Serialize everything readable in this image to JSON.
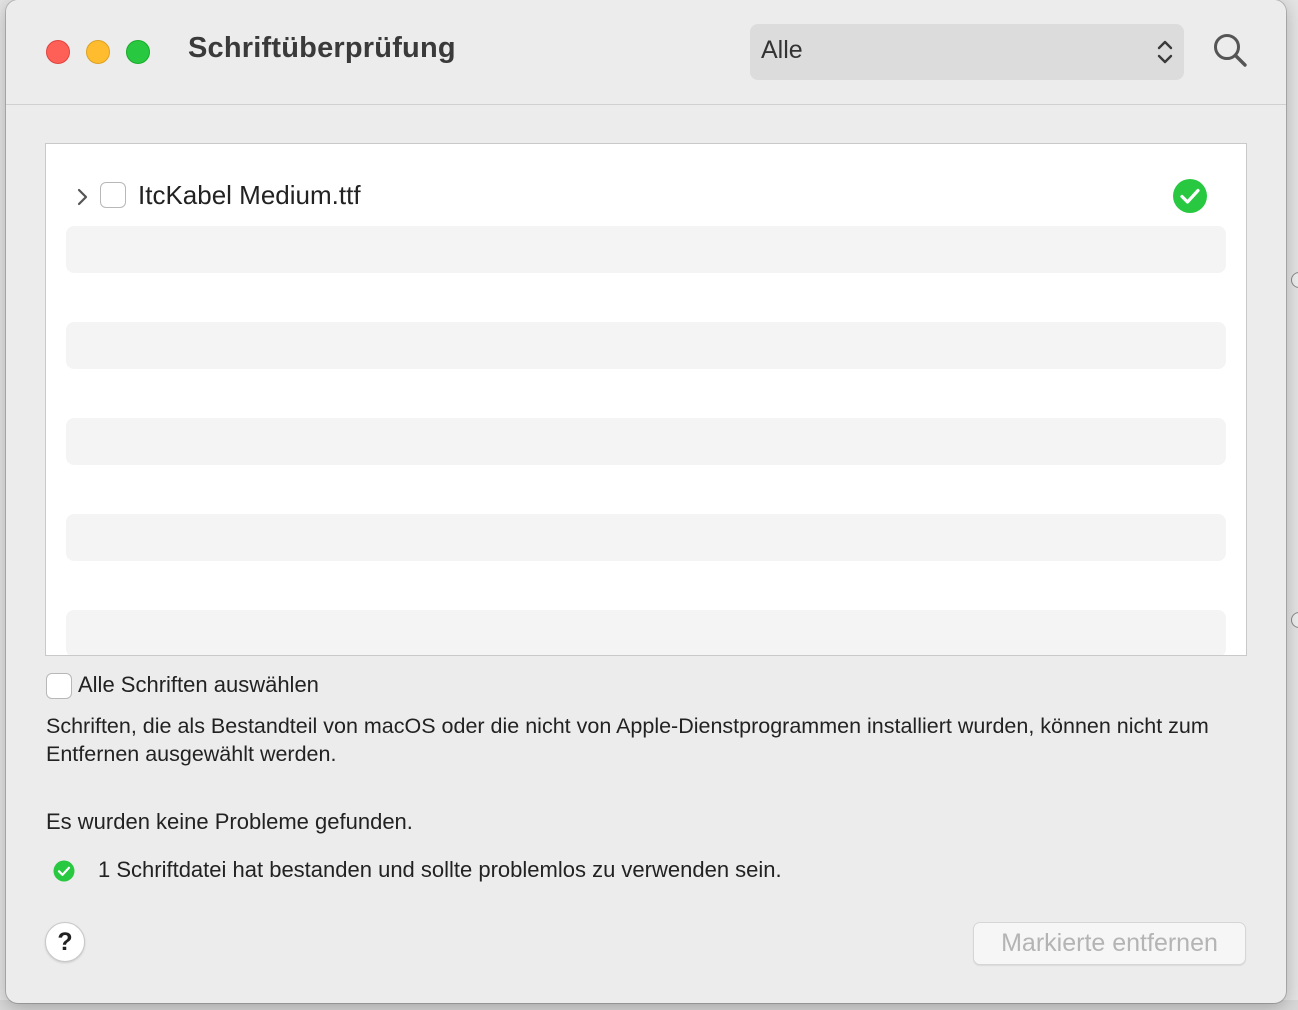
{
  "window": {
    "title": "Schriftüberprüfung",
    "filter": {
      "selected": "Alle"
    }
  },
  "fontlist": {
    "items": [
      {
        "name": "ItcKabel Medium.ttf",
        "status": "passed",
        "status_color": "#28c840"
      }
    ]
  },
  "select_all": {
    "label": "Alle Schriften auswählen"
  },
  "note": "Schriften, die als Bestandteil von macOS oder die nicht von Apple-Dienstprogrammen installiert wurden, können nicht zum Entfernen ausgewählt werden.",
  "results": {
    "summary": "Es wurden keine Probleme gefunden.",
    "passed_text": "1 Schriftdatei hat bestanden und sollte problemlos zu verwenden sein."
  },
  "buttons": {
    "help": "?",
    "remove_marked": "Markierte entfernen"
  },
  "colors": {
    "close": "#fe5f57",
    "minimize": "#febc2e",
    "zoom": "#28c840",
    "success": "#28c840"
  }
}
